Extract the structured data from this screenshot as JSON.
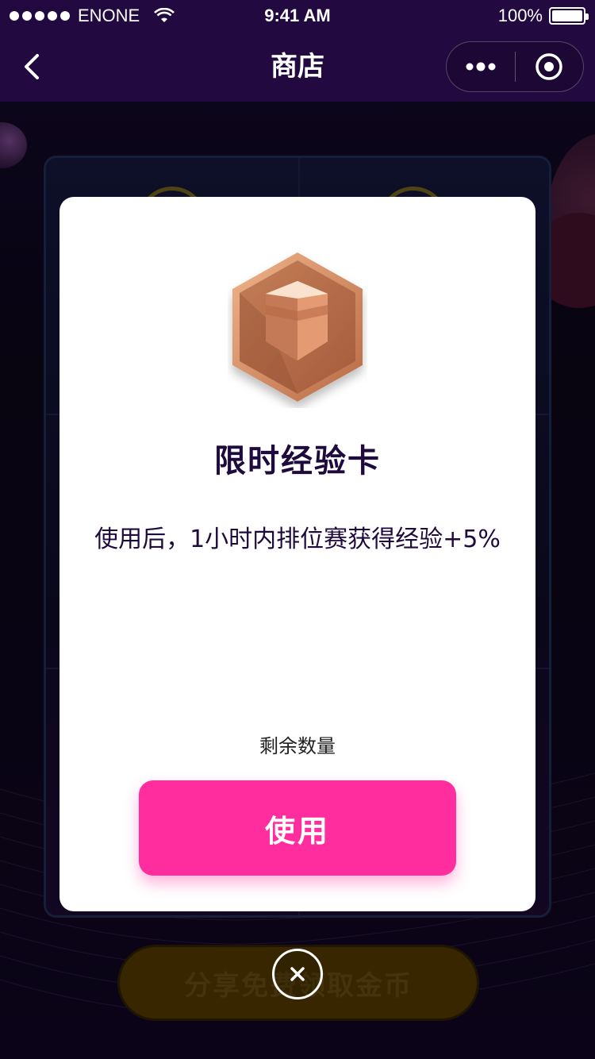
{
  "status_bar": {
    "carrier": "ENONE",
    "time": "9:41 AM",
    "battery": "100%",
    "battery_level": 1.0
  },
  "nav": {
    "title": "商店",
    "back_icon": "chevron-left-icon",
    "more_icon": "more-dots-icon",
    "close_icon": "target-circle-icon"
  },
  "background": {
    "share_button_label": "分享免费领取金币"
  },
  "modal": {
    "item_icon": "bronze-hexagon-card-icon",
    "item_title": "限时经验卡",
    "description": "使用后，1小时内排位赛获得经验+5%",
    "remaining_label": "剩余数量",
    "use_button_label": "使用",
    "close_icon": "close-circle-icon"
  },
  "colors": {
    "nav_bg": "#22093f",
    "primary_button": "#ff2d9d",
    "title_text": "#1e0a3c",
    "item_icon_bronze": "#b8734f"
  }
}
